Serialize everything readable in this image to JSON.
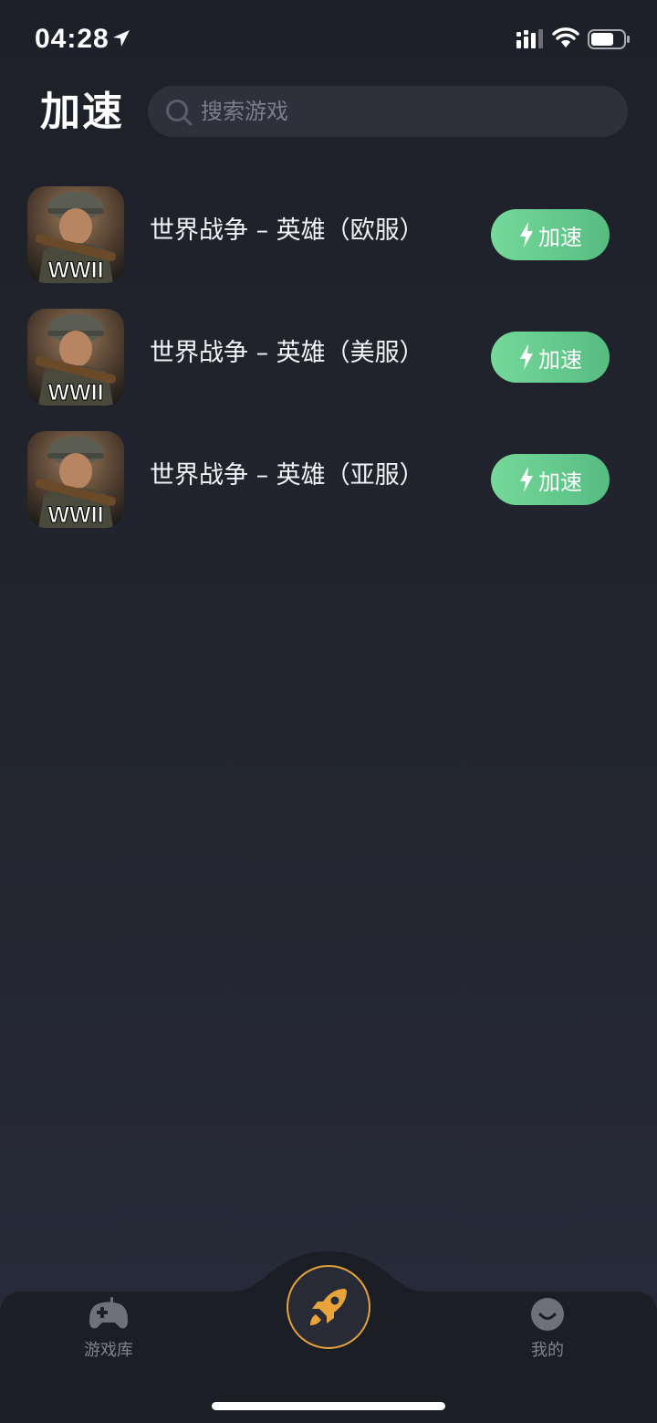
{
  "status_bar": {
    "time": "04:28"
  },
  "header": {
    "title": "加速",
    "search_placeholder": "搜索游戏"
  },
  "games": [
    {
      "name": "世界战争 – 英雄（欧服）",
      "thumb_text": "WWII",
      "button_label": "加速"
    },
    {
      "name": "世界战争 – 英雄（美服）",
      "thumb_text": "WWII",
      "button_label": "加速"
    },
    {
      "name": "世界战争 – 英雄（亚服）",
      "thumb_text": "WWII",
      "button_label": "加速"
    }
  ],
  "tabbar": {
    "left_label": "游戏库",
    "right_label": "我的"
  },
  "colors": {
    "accent_green": "#66c98c",
    "accent_orange": "#e8a33a"
  },
  "icons": {
    "left_tab": "gamepad-icon",
    "center_tab": "rocket-icon",
    "right_tab": "smile-face-icon"
  }
}
